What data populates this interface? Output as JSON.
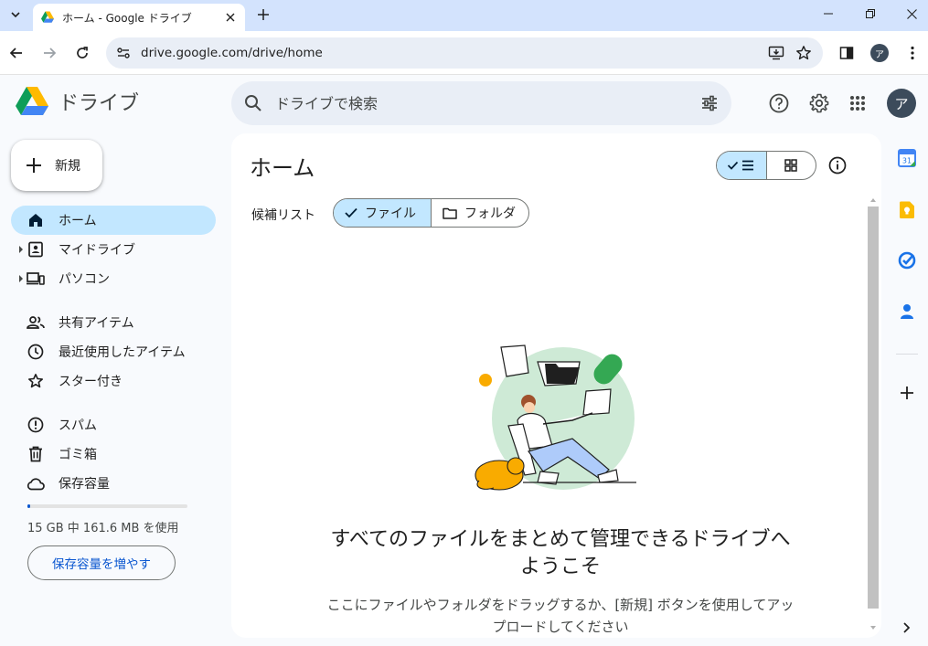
{
  "browser": {
    "tab_title": "ホーム - Google ドライブ",
    "url": "drive.google.com/drive/home",
    "profile_initial": "ア"
  },
  "app": {
    "logo_text": "ドライブ",
    "search_placeholder": "ドライブで検索",
    "avatar_initial": "ア"
  },
  "nav": {
    "new_label": "新規",
    "items": [
      {
        "label": "ホーム",
        "icon": "home-icon",
        "active": true
      },
      {
        "label": "マイドライブ",
        "icon": "my-drive-icon"
      },
      {
        "label": "パソコン",
        "icon": "computers-icon"
      },
      {
        "label": "共有アイテム",
        "icon": "shared-icon"
      },
      {
        "label": "最近使用したアイテム",
        "icon": "recent-icon"
      },
      {
        "label": "スター付き",
        "icon": "star-icon"
      },
      {
        "label": "スパム",
        "icon": "spam-icon"
      },
      {
        "label": "ゴミ箱",
        "icon": "trash-icon"
      },
      {
        "label": "保存容量",
        "icon": "cloud-icon"
      }
    ],
    "storage_used_fraction": 0.01,
    "storage_text": "15 GB 中 161.6 MB を使用",
    "storage_button": "保存容量を増やす"
  },
  "main": {
    "title": "ホーム",
    "suggestions_label": "候補リスト",
    "chip_files": "ファイル",
    "chip_folders": "フォルダ",
    "welcome_line1": "すべてのファイルをまとめて管理できるドライブへ",
    "welcome_line2": "ようこそ",
    "sub_line1": "ここにファイルやフォルダをドラッグするか、[新規] ボタンを使用してアッ",
    "sub_line2": "プロードしてください"
  },
  "colors": {
    "accent": "#0b57d0",
    "active_bg": "#c2e7ff",
    "tabstrip": "#d3e3fd"
  }
}
